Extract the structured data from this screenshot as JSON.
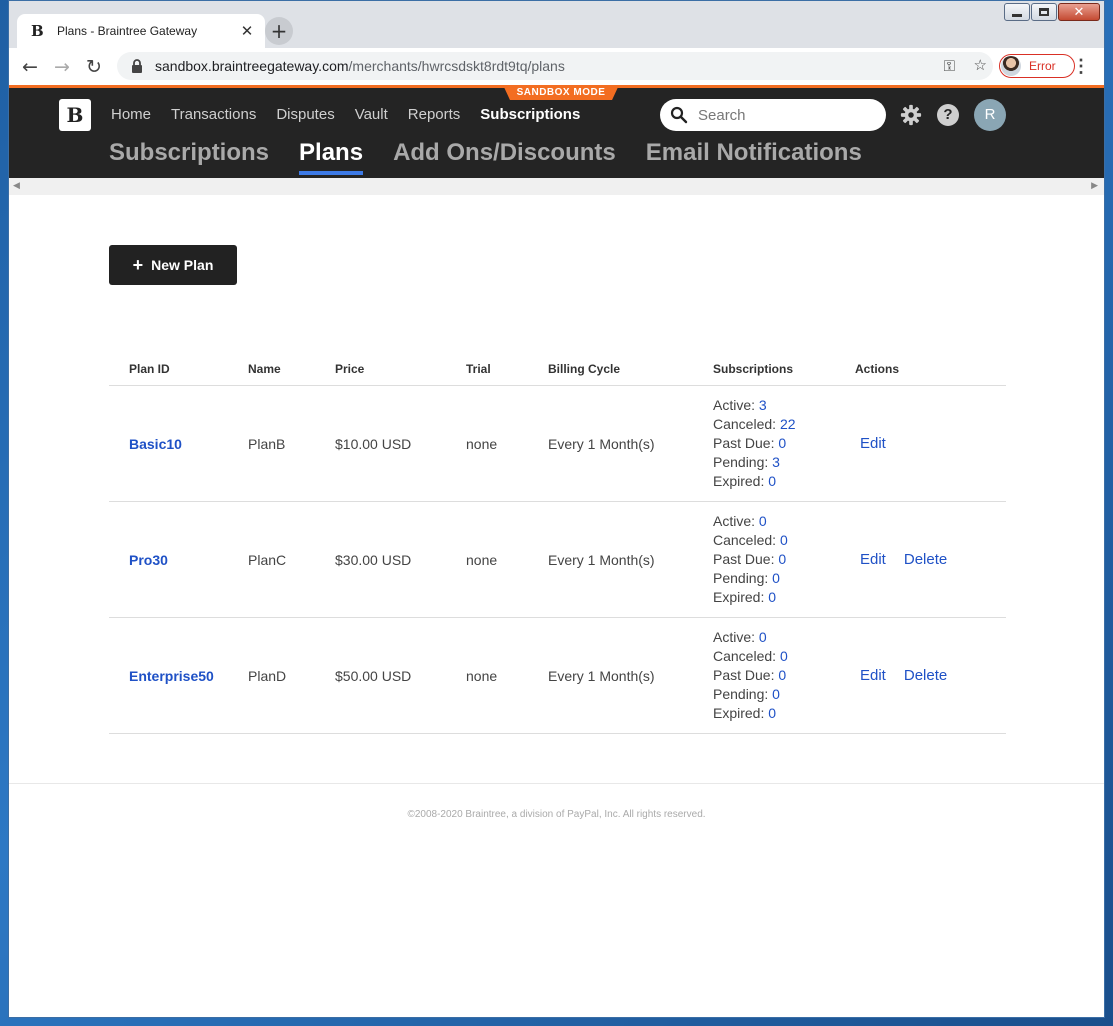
{
  "browser": {
    "tab_title": "Plans - Braintree Gateway",
    "tab_favicon": "B",
    "url_domain": "sandbox.braintreegateway.com",
    "url_path": "/merchants/hwrcsdskt8rdt9tq/plans",
    "profile_status": "Error"
  },
  "header": {
    "logo": "B",
    "sandbox_badge": "SANDBOX MODE",
    "nav": [
      "Home",
      "Transactions",
      "Disputes",
      "Vault",
      "Reports",
      "Subscriptions"
    ],
    "active_nav": "Subscriptions",
    "search_placeholder": "Search",
    "help": "?",
    "avatar": "R",
    "subtabs": [
      "Subscriptions",
      "Plans",
      "Add Ons/Discounts",
      "Email Notifications"
    ],
    "active_subtab": "Plans"
  },
  "new_plan_label": "New Plan",
  "table": {
    "headers": [
      "Plan ID",
      "Name",
      "Price",
      "Trial",
      "Billing Cycle",
      "Subscriptions",
      "Actions"
    ],
    "rows": [
      {
        "plan_id": "Basic10",
        "name": "PlanB",
        "price": "$10.00 USD",
        "trial": "none",
        "billing_cycle": "Every 1 Month(s)",
        "subscriptions": [
          [
            "Active:",
            "3"
          ],
          [
            "Canceled:",
            "22"
          ],
          [
            "Past Due:",
            "0"
          ],
          [
            "Pending:",
            "3"
          ],
          [
            "Expired:",
            "0"
          ]
        ],
        "actions": [
          "Edit"
        ]
      },
      {
        "plan_id": "Pro30",
        "name": "PlanC",
        "price": "$30.00 USD",
        "trial": "none",
        "billing_cycle": "Every 1 Month(s)",
        "subscriptions": [
          [
            "Active:",
            "0"
          ],
          [
            "Canceled:",
            "0"
          ],
          [
            "Past Due:",
            "0"
          ],
          [
            "Pending:",
            "0"
          ],
          [
            "Expired:",
            "0"
          ]
        ],
        "actions": [
          "Edit",
          "Delete"
        ]
      },
      {
        "plan_id": "Enterprise50",
        "name": "PlanD",
        "price": "$50.00 USD",
        "trial": "none",
        "billing_cycle": "Every 1 Month(s)",
        "subscriptions": [
          [
            "Active:",
            "0"
          ],
          [
            "Canceled:",
            "0"
          ],
          [
            "Past Due:",
            "0"
          ],
          [
            "Pending:",
            "0"
          ],
          [
            "Expired:",
            "0"
          ]
        ],
        "actions": [
          "Edit",
          "Delete"
        ]
      }
    ]
  },
  "footer": "©2008-2020 Braintree, a division of PayPal, Inc. All rights reserved."
}
